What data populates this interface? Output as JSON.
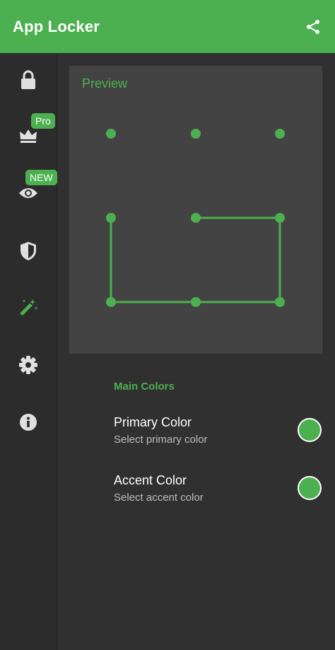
{
  "app": {
    "title": "App Locker"
  },
  "icons": {
    "share": "share-icon",
    "lock": "lock-icon",
    "crown": "crown-icon",
    "eye": "eye-icon",
    "shield": "shield-icon",
    "wand": "magic-wand-icon",
    "gear": "gear-icon",
    "info": "info-icon"
  },
  "rail": {
    "badges": {
      "pro": "Pro",
      "new": "NEW"
    }
  },
  "preview": {
    "title": "Preview"
  },
  "settings": {
    "section_title": "Main Colors",
    "primary": {
      "title": "Primary Color",
      "subtitle": "Select primary color",
      "color": "#4caf50"
    },
    "accent": {
      "title": "Accent Color",
      "subtitle": "Select accent color",
      "color": "#4caf50"
    }
  },
  "colors": {
    "accent": "#4caf50",
    "rail_icon": "#e0e0e0",
    "appbar": "#4caf50"
  }
}
